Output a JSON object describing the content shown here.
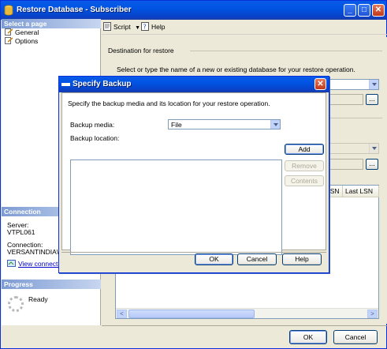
{
  "window": {
    "title": "Restore Database - Subscriber",
    "controls": {
      "minimize": "_",
      "maximize": "□",
      "close": "✕"
    }
  },
  "left_pane": {
    "select_page_header": "Select a page",
    "pages": [
      {
        "label": "General",
        "icon": "page-icon"
      },
      {
        "label": "Options",
        "icon": "page-icon"
      }
    ],
    "connection_header": "Connection",
    "server_label": "Server:",
    "server_value": "VTPL061",
    "connection_label": "Connection:",
    "connection_value": "VERSANTINDIA\\s",
    "view_connection_link": "View connectio",
    "progress_header": "Progress",
    "progress_status": "Ready"
  },
  "toolbar": {
    "script_label": "Script",
    "help_label": "Help"
  },
  "main": {
    "destination_header": "Destination for restore",
    "destination_text": "Select or type the name of a new or existing database for your restore operation.",
    "grid_columns": [
      "LSN",
      "Last LSN"
    ],
    "scroll_left": "<",
    "scroll_right": ">"
  },
  "footer": {
    "ok_label": "OK",
    "cancel_label": "Cancel"
  },
  "dialog": {
    "title": "Specify Backup",
    "close": "✕",
    "description": "Specify the backup media and its location for your restore operation.",
    "backup_media_label": "Backup media:",
    "backup_media_value": "File",
    "backup_location_label": "Backup location:",
    "add_label": "Add",
    "remove_label": "Remove",
    "contents_label": "Contents",
    "ok_label": "OK",
    "cancel_label": "Cancel",
    "help_label": "Help"
  },
  "colors": {
    "titlebar": "#0054e3",
    "window_face": "#ece9d8",
    "section_header": "#7d9bd3",
    "link": "#0000cc"
  }
}
